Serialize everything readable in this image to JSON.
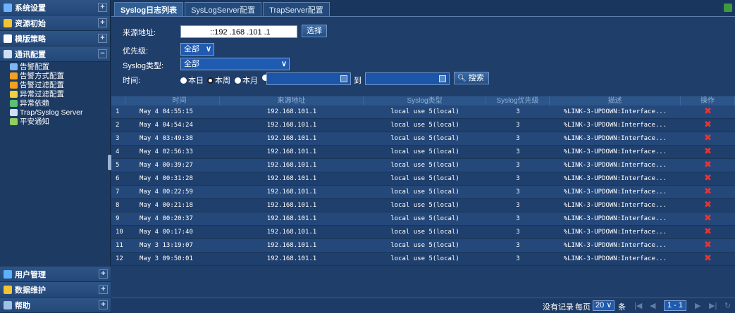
{
  "sidebar": {
    "sections_top": [
      {
        "label": "系统设置",
        "expanded": false,
        "color": "#6fb3ff"
      },
      {
        "label": "资源初始",
        "expanded": false,
        "color": "#f4c430"
      },
      {
        "label": "模版策略",
        "expanded": false,
        "color": "#ffffff"
      },
      {
        "label": "通讯配置",
        "expanded": true,
        "color": "#cfe0f5"
      }
    ],
    "sub_items": [
      {
        "label": "告警配置",
        "color": "#7fb6f0"
      },
      {
        "label": "告警方式配置",
        "color": "#f4a020"
      },
      {
        "label": "告警过滤配置",
        "color": "#f4a020"
      },
      {
        "label": "异常过滤配置",
        "color": "#f0d040"
      },
      {
        "label": "异常依赖",
        "color": "#5fc06f"
      },
      {
        "label": "Trap/Syslog Server",
        "color": "#cfe0f5"
      },
      {
        "label": "平安通知",
        "color": "#8fd05f"
      }
    ],
    "sections_bottom": [
      {
        "label": "用户管理",
        "color": "#5fb0ff"
      },
      {
        "label": "数据维护",
        "color": "#f4c430"
      },
      {
        "label": "帮助",
        "color": "#9fc0e8"
      }
    ],
    "plus": "+",
    "minus": "−"
  },
  "tabs": [
    {
      "label": "Syslog日志列表",
      "active": true
    },
    {
      "label": "SysLogServer配置",
      "active": false
    },
    {
      "label": "TrapServer配置",
      "active": false
    }
  ],
  "form": {
    "source_label": "来源地址:",
    "source_value": "::192  .168  .101  .1",
    "select_button": "选择",
    "priority_label": "优先级:",
    "priority_value": "全部",
    "type_label": "Syslog类型:",
    "type_value": "全部",
    "time_label": "时间:",
    "radio_today": "本日",
    "radio_week": "本周",
    "radio_month": "本月",
    "to_label": "到",
    "search_button": "搜索",
    "dropdown_arrow": "∨"
  },
  "table": {
    "headers": [
      "",
      "时间",
      "来源地址",
      "Syslog类型",
      "Syslog优先级",
      "描述",
      "操作"
    ],
    "rows": [
      [
        "1",
        "May 4 04:55:15",
        "192.168.101.1",
        "local use 5(local)",
        "3",
        "%LINK-3-UPDOWN:Interface..."
      ],
      [
        "2",
        "May 4 04:54:24",
        "192.168.101.1",
        "local use 5(local)",
        "3",
        "%LINK-3-UPDOWN:Interface..."
      ],
      [
        "3",
        "May 4 03:49:38",
        "192.168.101.1",
        "local use 5(local)",
        "3",
        "%LINK-3-UPDOWN:Interface..."
      ],
      [
        "4",
        "May 4 02:56:33",
        "192.168.101.1",
        "local use 5(local)",
        "3",
        "%LINK-3-UPDOWN:Interface..."
      ],
      [
        "5",
        "May 4 00:39:27",
        "192.168.101.1",
        "local use 5(local)",
        "3",
        "%LINK-3-UPDOWN:Interface..."
      ],
      [
        "6",
        "May 4 00:31:28",
        "192.168.101.1",
        "local use 5(local)",
        "3",
        "%LINK-3-UPDOWN:Interface..."
      ],
      [
        "7",
        "May 4 00:22:59",
        "192.168.101.1",
        "local use 5(local)",
        "3",
        "%LINK-3-UPDOWN:Interface..."
      ],
      [
        "8",
        "May 4 00:21:18",
        "192.168.101.1",
        "local use 5(local)",
        "3",
        "%LINK-3-UPDOWN:Interface..."
      ],
      [
        "9",
        "May 4 00:20:37",
        "192.168.101.1",
        "local use 5(local)",
        "3",
        "%LINK-3-UPDOWN:Interface..."
      ],
      [
        "10",
        "May 4 00:17:40",
        "192.168.101.1",
        "local use 5(local)",
        "3",
        "%LINK-3-UPDOWN:Interface..."
      ],
      [
        "11",
        "May 3 13:19:07",
        "192.168.101.1",
        "local use 5(local)",
        "3",
        "%LINK-3-UPDOWN:Interface..."
      ],
      [
        "12",
        "May 3 09:50:01",
        "192.168.101.1",
        "local use 5(local)",
        "3",
        "%LINK-3-UPDOWN:Interface..."
      ]
    ],
    "delete_glyph": "✖"
  },
  "pager": {
    "no_records": "没有记录",
    "per_page_label": "每页",
    "per_page_value": "20",
    "per_page_unit": "条",
    "first": "|◀",
    "prev": "◀",
    "page_range": "1 - 1",
    "next": "▶",
    "last": "▶|",
    "refresh": "↻"
  }
}
